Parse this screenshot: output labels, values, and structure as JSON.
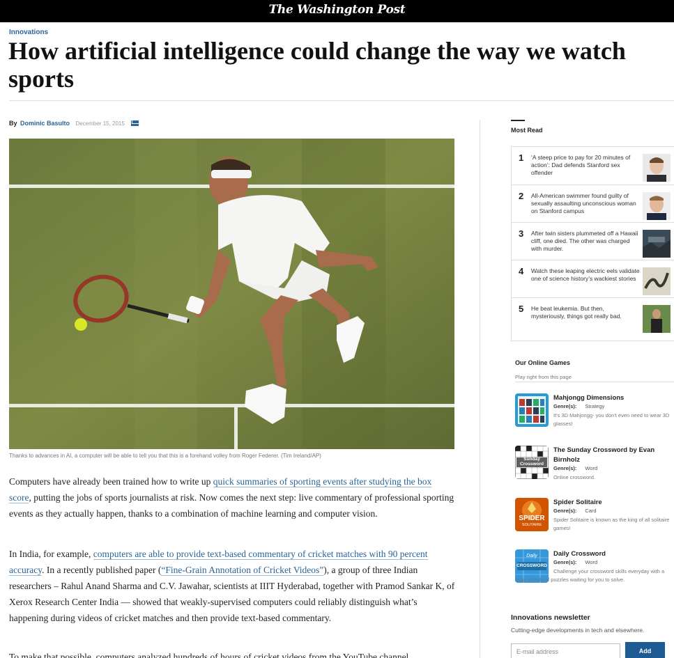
{
  "header": {
    "masthead": "The Washington Post"
  },
  "article": {
    "section": "Innovations",
    "headline": "How artificial intelligence could change the way we watch sports",
    "byline_prefix": "By",
    "author": "Dominic Basulto",
    "date": "December 15, 2015",
    "photo_caption": "Thanks to advances in AI, a computer will be able to tell you that this is a forehand volley from Roger Federer. (Tim Ireland/AP)",
    "p1": {
      "t1": "Computers have already been trained how to write up ",
      "link1": "quick summaries of sporting events after studying the box score",
      "t2": ", putting the jobs of sports journalists at risk. Now comes the next step: live commentary of professional sporting events as they actually happen, thanks to a combination of machine learning and computer vision."
    },
    "p2": {
      "t1": "In India, for example, ",
      "link1": "computers are able to provide text-based commentary of cricket matches with 90 percent accuracy",
      "t2": ". In a recently published paper (",
      "link2": "“Fine-Grain Annotation of Cricket Videos”",
      "t3": "), a group of three Indian researchers – Rahul Anand Sharma and C.V. Jawahar, scientists at IIIT Hyderabad, together with Pramod Sankar K, of Xerox Research Center India — showed that weakly-supervised computers could reliably distinguish what’s happening during videos of cricket matches and then provide text-based commentary."
    },
    "p3": "To make that possible, computers analyzed hundreds of hours of cricket videos from the YouTube channel"
  },
  "most_read": {
    "title": "Most Read",
    "items": [
      {
        "num": "1",
        "text": "‘A steep price to pay for 20 minutes of action’: Dad defends Stanford sex offender"
      },
      {
        "num": "2",
        "text": "All-American swimmer found guilty of sexually assaulting unconscious woman on Stanford campus"
      },
      {
        "num": "3",
        "text": "After twin sisters plummeted off a Hawaii cliff, one died. The other was charged with murder."
      },
      {
        "num": "4",
        "text": "Watch these leaping electric eels validate one of science history’s wackiest stories"
      },
      {
        "num": "5",
        "text": "He beat leukemia. But then, mysteriously, things got really bad."
      }
    ]
  },
  "games": {
    "title": "Our Online Games",
    "subtitle": "Play right from this page",
    "genre_label": "Genre(s):",
    "items": [
      {
        "name": "Mahjongg Dimensions",
        "genre": "Strategy",
        "desc": "It's 3D Mahjongg- you don't even need to wear 3D glasses!"
      },
      {
        "name": "The Sunday Crossword by Evan Birnholz",
        "genre": "Word",
        "desc": "Online crossword."
      },
      {
        "name": "Spider Solitaire",
        "genre": "Card",
        "desc": "Spider Solitaire is known as the king of all solitaire games!"
      },
      {
        "name": "Daily Crossword",
        "genre": "Word",
        "desc": "Challenge your crossword skills everyday with a huge variety of puzzles waiting for you to solve."
      }
    ],
    "icon_text": {
      "sunday": "Sunday Crossword",
      "spider": "SPIDER",
      "spider_sub": "SOLITAIRE",
      "daily_top": "Daily",
      "daily": "CROSSWORD"
    }
  },
  "newsletter": {
    "title": "Innovations newsletter",
    "subtitle": "Cutting-edge developments in tech and elsewhere.",
    "placeholder": "E-mail address",
    "button": "Add"
  },
  "colors": {
    "link": "#2a6496",
    "button": "#1e5a93",
    "court": "#6d7a3a"
  }
}
